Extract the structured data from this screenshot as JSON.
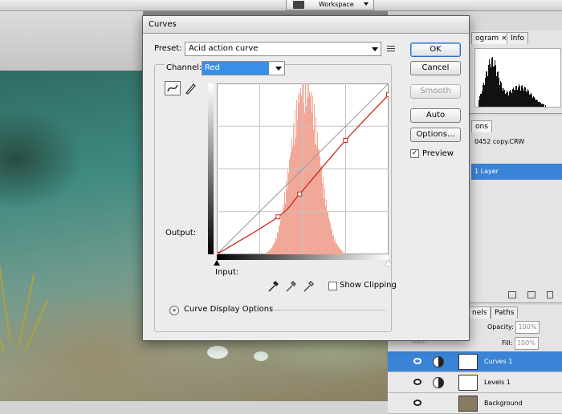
{
  "app": {
    "workspace_label": "Workspace"
  },
  "panels": {
    "histogram_tabs": [
      "ogram",
      "Info"
    ],
    "histogram_tab_close": "×",
    "history_tab": "ons",
    "history_doc": "0452 copy.CRW",
    "history_layer": "1 Layer",
    "layers_tabs": [
      "nels",
      "Paths"
    ],
    "opacity_label": "Opacity:",
    "opacity_value": "100%",
    "fill_label": "Fill:",
    "fill_value": "100%",
    "lock_label": "Lock:",
    "layers": [
      {
        "name": "Curves 1",
        "selected": true
      },
      {
        "name": "Levels 1",
        "selected": false
      },
      {
        "name": "Background",
        "selected": false
      }
    ]
  },
  "dialog": {
    "title": "Curves",
    "preset_label": "Preset:",
    "preset_value": "Acid action curve",
    "channel_label": "Channel:",
    "channel_value": "Red",
    "output_label": "Output:",
    "input_label": "Input:",
    "show_clipping_label": "Show Clipping",
    "curve_display_options_label": "Curve Display Options",
    "buttons": {
      "ok": "OK",
      "cancel": "Cancel",
      "smooth": "Smooth",
      "auto": "Auto",
      "options": "Options..."
    },
    "preview_label": "Preview",
    "preview_checked": true,
    "show_clipping_checked": false
  },
  "colors": {
    "curve": "#c8261c",
    "histogram": "#f2a898",
    "selection": "#3b83d6",
    "channel_highlight": "#3b8ee8"
  },
  "curve": {
    "channel": "Red",
    "range": [
      0,
      255
    ],
    "points": [
      {
        "input": 0,
        "output": 0
      },
      {
        "input": 91,
        "output": 56
      },
      {
        "input": 123,
        "output": 90
      },
      {
        "input": 191,
        "output": 170
      },
      {
        "input": 255,
        "output": 238
      }
    ]
  }
}
